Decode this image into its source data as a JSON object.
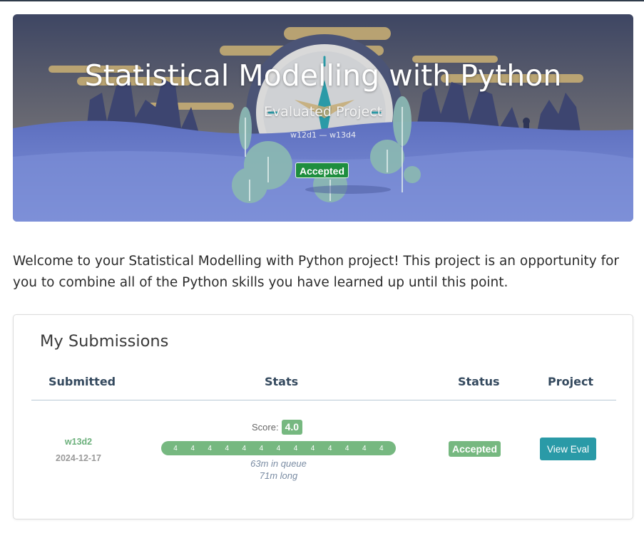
{
  "hero": {
    "title": "Statistical Modelling with Python",
    "subtitle": "Evaluated Project",
    "week_range": "w12d1 — w13d4",
    "status_badge": "Accepted",
    "colors": {
      "sky_top": "#3e4663",
      "sky_bottom": "#a8996d",
      "water": "#6a7dc8",
      "badge": "#1e8e3e"
    }
  },
  "intro": "Welcome to your Statistical Modelling with Python project! This project is an opportunity for you to combine all of the Python skills you have learned up until this point.",
  "submissions": {
    "title": "My Submissions",
    "columns": [
      "Submitted",
      "Stats",
      "Status",
      "Project"
    ],
    "rows": [
      {
        "week": "w13d2",
        "date": "2024-12-17",
        "score_label": "Score:",
        "score": "4.0",
        "criteria_scores": [
          "4",
          "4",
          "4",
          "4",
          "4",
          "4",
          "4",
          "4",
          "4",
          "4",
          "4",
          "4",
          "4"
        ],
        "queue_time": "63m in queue",
        "duration": "71m long",
        "status": "Accepted",
        "action_label": "View Eval"
      }
    ]
  },
  "colors": {
    "accent_green": "#76b880",
    "button_teal": "#2a9aa7",
    "heading": "#34495e"
  }
}
